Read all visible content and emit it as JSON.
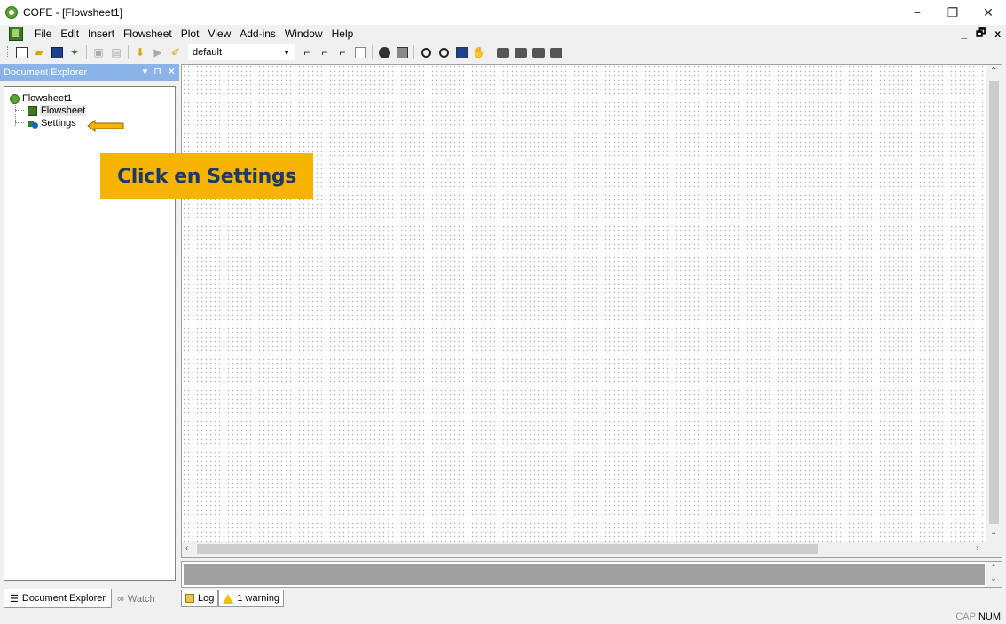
{
  "window": {
    "title": "COFE - [Flowsheet1]",
    "controls": {
      "minimize": "−",
      "restore": "❐",
      "close": "✕"
    }
  },
  "menubar": {
    "items": [
      "File",
      "Edit",
      "Insert",
      "Flowsheet",
      "Plot",
      "View",
      "Add-ins",
      "Window",
      "Help"
    ],
    "mdi_controls": {
      "minimize": "_",
      "restore": "🗗",
      "close": "x"
    }
  },
  "toolbar": {
    "unit_set": "default"
  },
  "document_explorer": {
    "title": "Document Explorer",
    "header_controls": {
      "dropdown": "▾",
      "pin": "⊓",
      "close": "✕"
    },
    "tree": {
      "root": "Flowsheet1",
      "children": [
        "Flowsheet",
        "Settings"
      ]
    },
    "tabs": [
      "Document Explorer",
      "Watch"
    ]
  },
  "annotation": {
    "callout_text": "Click en Settings",
    "arrow_color": "#f5b400"
  },
  "log_panel": {
    "tabs": [
      "Log",
      "1 warning"
    ]
  },
  "statusbar": {
    "caps": "CAP",
    "num": "NUM"
  },
  "colors": {
    "explorer_header": "#8ab4e8",
    "callout_bg": "#f5b400",
    "callout_text": "#1f3864"
  }
}
